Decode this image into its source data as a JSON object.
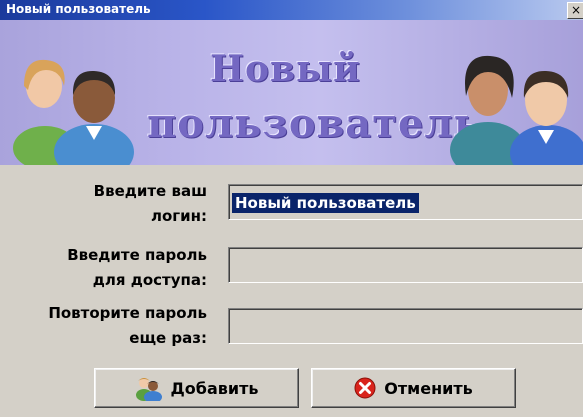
{
  "window": {
    "title": "Новый пользователь",
    "close_glyph": "×"
  },
  "banner": {
    "line1": "Новый",
    "line2": "пользователь"
  },
  "form": {
    "login_label_1": "Введите ваш",
    "login_label_2": "логин:",
    "login_value": "Новый пользователь",
    "password_label_1": "Введите пароль",
    "password_label_2": "для доступа:",
    "password_value": "",
    "repeat_label_1": "Повторите пароль",
    "repeat_label_2": "еще раз:",
    "repeat_value": ""
  },
  "buttons": {
    "add_label": "Добавить",
    "add_icon": "users-icon",
    "cancel_label": "Отменить",
    "cancel_icon": "cancel-circle-icon",
    "cancel_color": "#d9241c"
  }
}
